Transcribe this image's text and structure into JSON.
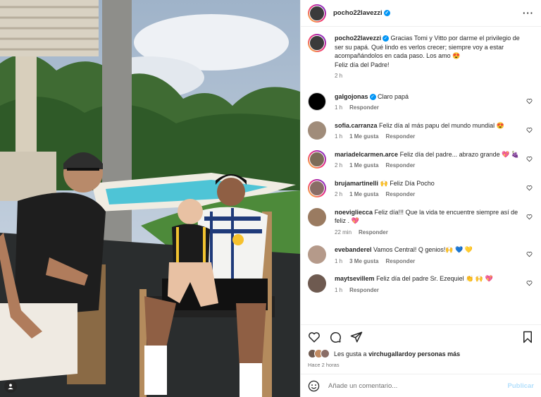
{
  "post": {
    "author": "pocho22lavezzi",
    "caption": "Gracias Tomi y Vitto por darme el privilegio de ser su papá. Qué lindo es verlos crecer; siempre voy a estar acompañándolos en cada paso. Los amo 😍",
    "caption_line2": "Feliz día del Padre!",
    "caption_time": "2 h"
  },
  "comments": [
    {
      "user": "galgojonas",
      "verified": true,
      "text": "Claro papá",
      "time": "1 h",
      "likes": "",
      "reply": "Responder"
    },
    {
      "user": "sofia.carranza",
      "verified": false,
      "text": "Feliz día al más papu del mundo mundial 😍",
      "time": "1 h",
      "likes": "1 Me gusta",
      "reply": "Responder"
    },
    {
      "user": "mariadelcarmen.arce",
      "verified": false,
      "text": "Feliz día del padre... abrazo grande 💖 🍇",
      "time": "2 h",
      "likes": "1 Me gusta",
      "reply": "Responder"
    },
    {
      "user": "brujamartinelli",
      "verified": false,
      "text": "🙌 Feliz Día Pocho",
      "time": "2 h",
      "likes": "1 Me gusta",
      "reply": "Responder"
    },
    {
      "user": "noevigliecca",
      "verified": false,
      "text": "Feliz día!!! Que la vida te encuentre siempre así de feliz . 💖",
      "time": "22 min",
      "likes": "",
      "reply": "Responder"
    },
    {
      "user": "evebanderel",
      "verified": false,
      "text": "Vamos Central! Q genios!🙌 💙 💛",
      "time": "1 h",
      "likes": "3 Me gusta",
      "reply": "Responder"
    },
    {
      "user": "maytsevillem",
      "verified": false,
      "text": "Feliz día del padre Sr. Ezequiel 👏 🙌 💖",
      "time": "1 h",
      "likes": "",
      "reply": "Responder"
    }
  ],
  "likes_text_prefix": "Les gusta a ",
  "likes_user": "virchugallardo",
  "likes_text_suffix": " y personas más",
  "posted_ago": "Hace 2 horas",
  "comment_placeholder": "Añade un comentario...",
  "post_button": "Publicar",
  "colors": {
    "accent": "#0095f6",
    "muted": "#737373",
    "heart": "#ed4956"
  }
}
